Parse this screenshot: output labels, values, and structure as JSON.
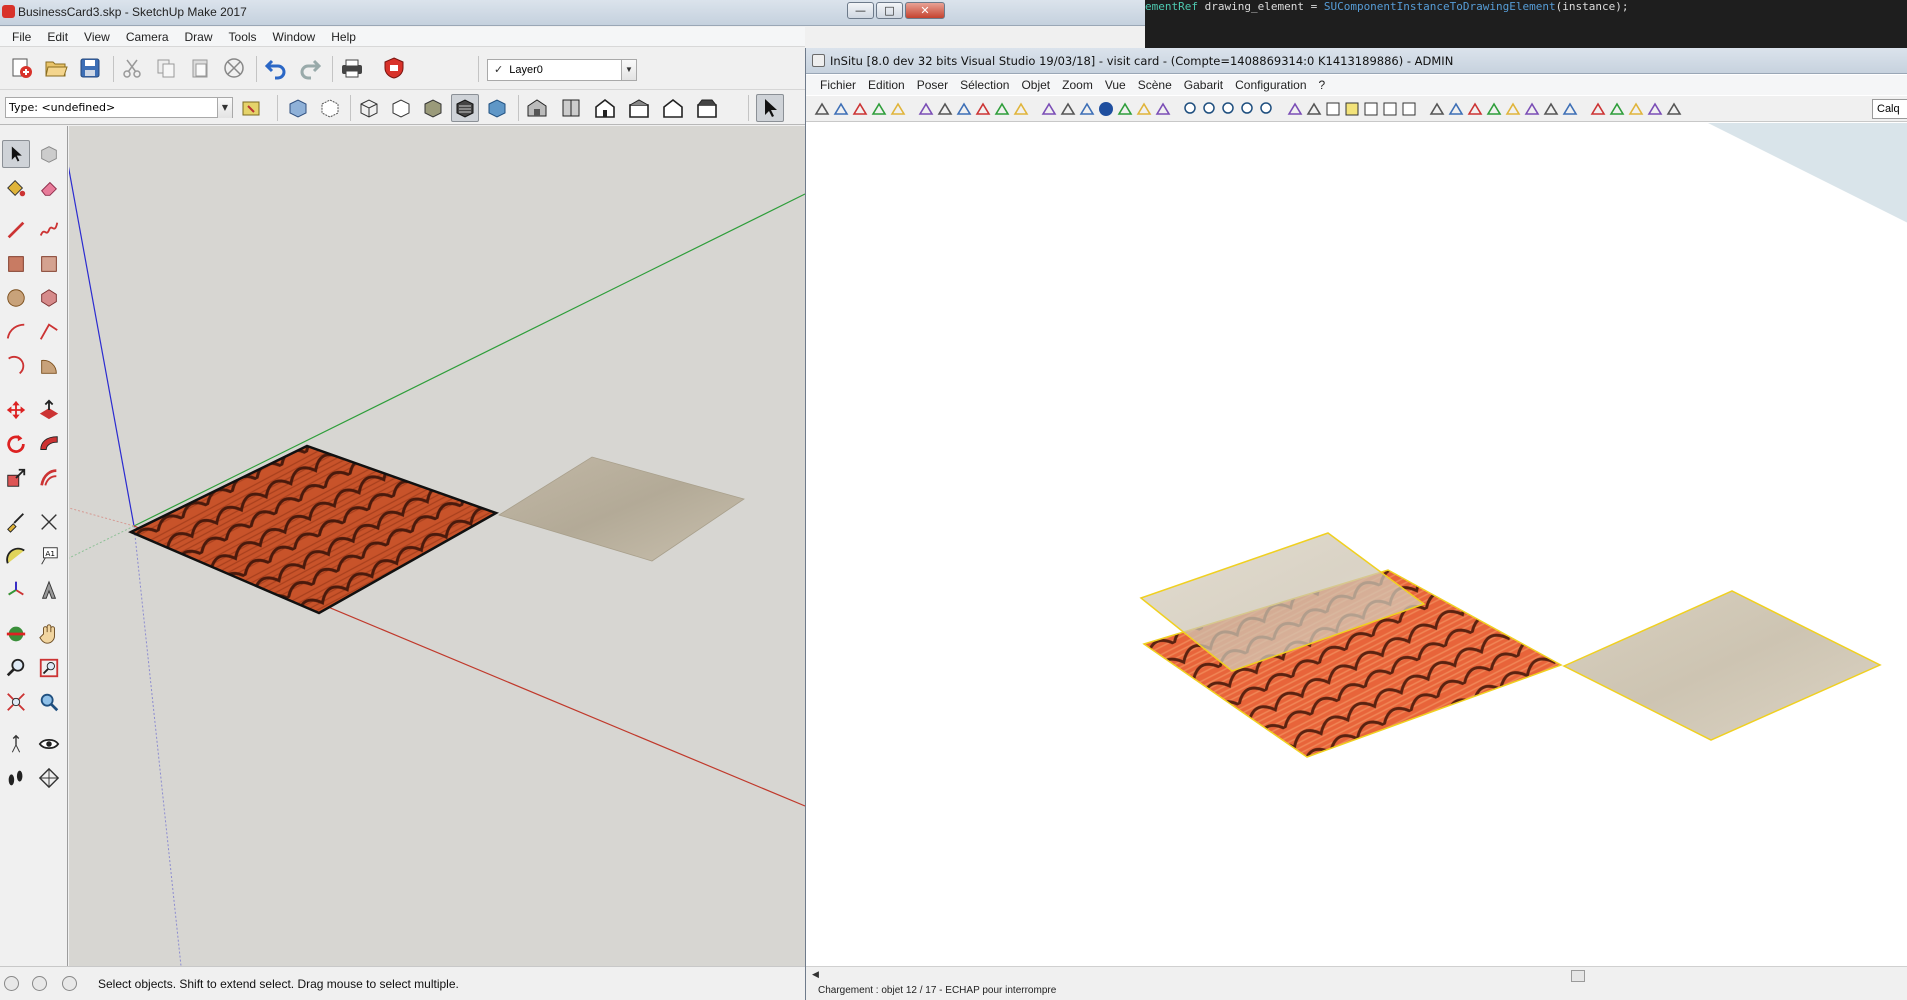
{
  "sketchup": {
    "title": "BusinessCard3.skp - SketchUp Make 2017",
    "window_buttons": {
      "minimize": "—",
      "maximize": "□",
      "close": "✕"
    },
    "menu": [
      "File",
      "Edit",
      "View",
      "Camera",
      "Draw",
      "Tools",
      "Window",
      "Help"
    ],
    "layer": {
      "checkmark": "✓",
      "name": "Layer0"
    },
    "type_field": "Type: <undefined>",
    "status": "Select objects. Shift to extend select. Drag mouse to select multiple.",
    "colors": {
      "viewport": "#d7d6d2",
      "roof_texture": "#c8532a",
      "paper_texture": "#bdb4a3",
      "axis_red": "#c0392b",
      "axis_green": "#2e9e3a",
      "axis_blue": "#2b2bd0"
    },
    "icons": {
      "toolbar1": [
        "new-model-icon",
        "open-icon",
        "save-icon",
        "cut-icon",
        "copy-icon",
        "paste-icon",
        "erase-icon",
        "undo-icon",
        "redo-icon",
        "print-icon",
        "model-info-icon"
      ],
      "toolbar2": [
        "paint-icon",
        "xray-icon",
        "back-edges-icon",
        "wireframe-icon",
        "hidden-line-icon",
        "shaded-icon",
        "shaded-textures-icon",
        "monochrome-icon",
        "iso-view-icon",
        "top-view-icon",
        "front-view-icon",
        "right-view-icon",
        "back-view-icon",
        "left-view-icon",
        "select-icon"
      ],
      "sidebar": [
        "select-icon",
        "component-icon",
        "paint-bucket-icon",
        "eraser-icon",
        "line-icon",
        "freehand-icon",
        "rectangle-icon",
        "rotated-rectangle-icon",
        "circle-icon",
        "polygon-icon",
        "arc-icon",
        "two-point-arc-icon",
        "three-point-arc-icon",
        "pie-icon",
        "move-icon",
        "push-pull-icon",
        "rotate-icon",
        "follow-me-icon",
        "scale-icon",
        "offset-icon",
        "tape-measure-icon",
        "dimension-icon",
        "protractor-icon",
        "text-icon",
        "axes-icon",
        "3d-text-icon",
        "orbit-icon",
        "pan-icon",
        "zoom-icon",
        "zoom-window-icon",
        "zoom-extents-icon",
        "previous-view-icon",
        "position-camera-icon",
        "look-around-icon",
        "walk-icon",
        "section-plane-icon"
      ]
    }
  },
  "code_editor": {
    "prefix": "ementRef",
    "middle": " drawing_element = ",
    "call": "SUComponentInstanceToDrawingElement",
    "args": "(instance);"
  },
  "insitu": {
    "title": "InSitu [8.0 dev 32 bits Visual Studio 19/03/18] - visit card - (Compte=1408869314:0 K1413189886) - ADMIN",
    "menu": [
      "Fichier",
      "Edition",
      "Poser",
      "Sélection",
      "Objet",
      "Zoom",
      "Vue",
      "Scène",
      "Gabarit",
      "Configuration",
      "?"
    ],
    "calque_label": "Calq",
    "status": "Chargement : objet 12 / 17 - ECHAP pour interrompre",
    "colors": {
      "selection_outline": "#f0d020",
      "roof_texture": "#e8643a",
      "paper_texture": "#d4ccbb"
    },
    "toolbar_icons": [
      "new-icon",
      "open-icon",
      "save-icon",
      "print-icon",
      "print-preview-icon",
      "eraser-icon",
      "cut-icon",
      "copy-icon",
      "paste-icon",
      "undo-icon",
      "delete-icon",
      "stairs-icon",
      "wall-icon",
      "measure-icon",
      "info-icon",
      "move-icon",
      "rotate-icon",
      "mirror-icon",
      "zoom-in-icon",
      "zoom-out-icon",
      "zoom-window-icon",
      "zoom-extents-icon",
      "zoom-previous-icon",
      "render-icon",
      "plan-icon",
      "square-icon",
      "yellow-square-icon",
      "box-icon",
      "box-outline-icon",
      "box-filled-icon",
      "camera-icon",
      "video-icon",
      "walk-icon",
      "play-icon",
      "sun-icon",
      "light-icon",
      "angle-icon",
      "paint-icon",
      "word-icon",
      "pdf-icon",
      "book-icon",
      "globe-icon",
      "help-icon"
    ]
  }
}
